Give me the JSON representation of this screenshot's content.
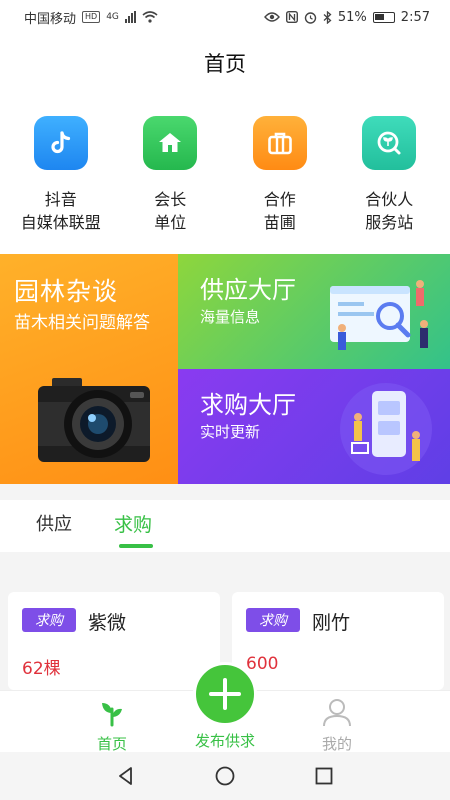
{
  "status_bar": {
    "carrier": "中国移动",
    "hd": "HD",
    "network": "4G",
    "battery": "51%",
    "time": "2:57"
  },
  "header": {
    "title": "首页"
  },
  "quick_links": [
    {
      "line1": "抖音",
      "line2": "自媒体联盟",
      "icon": "tiktok-icon",
      "color": "#1e96f3"
    },
    {
      "line1": "会长",
      "line2": "单位",
      "icon": "home-icon",
      "color": "#2fc35a"
    },
    {
      "line1": "合作",
      "line2": "苗圃",
      "icon": "briefcase-icon",
      "color": "#ff9a1f"
    },
    {
      "line1": "合伙人",
      "line2": "服务站",
      "icon": "search-plant-icon",
      "color": "#2cc9a8"
    }
  ],
  "banners": {
    "left": {
      "title": "园林杂谈",
      "subtitle": "苗木相关问题解答"
    },
    "top_right": {
      "title": "供应大厅",
      "subtitle": "海量信息"
    },
    "bottom_right": {
      "title": "求购大厅",
      "subtitle": "实时更新"
    }
  },
  "tabs": {
    "supply": "供应",
    "demand": "求购",
    "active": "demand"
  },
  "cards": [
    {
      "tag": "求购",
      "name": "紫微",
      "qty": "62棵"
    },
    {
      "tag": "求购",
      "name": "刚竹",
      "qty": "600"
    }
  ],
  "bottom_nav": {
    "home": "首页",
    "publish": "发布供求",
    "mine": "我的"
  },
  "colors": {
    "accent": "#38c046",
    "tag": "#7e4ee8",
    "qty": "#e0323c"
  }
}
